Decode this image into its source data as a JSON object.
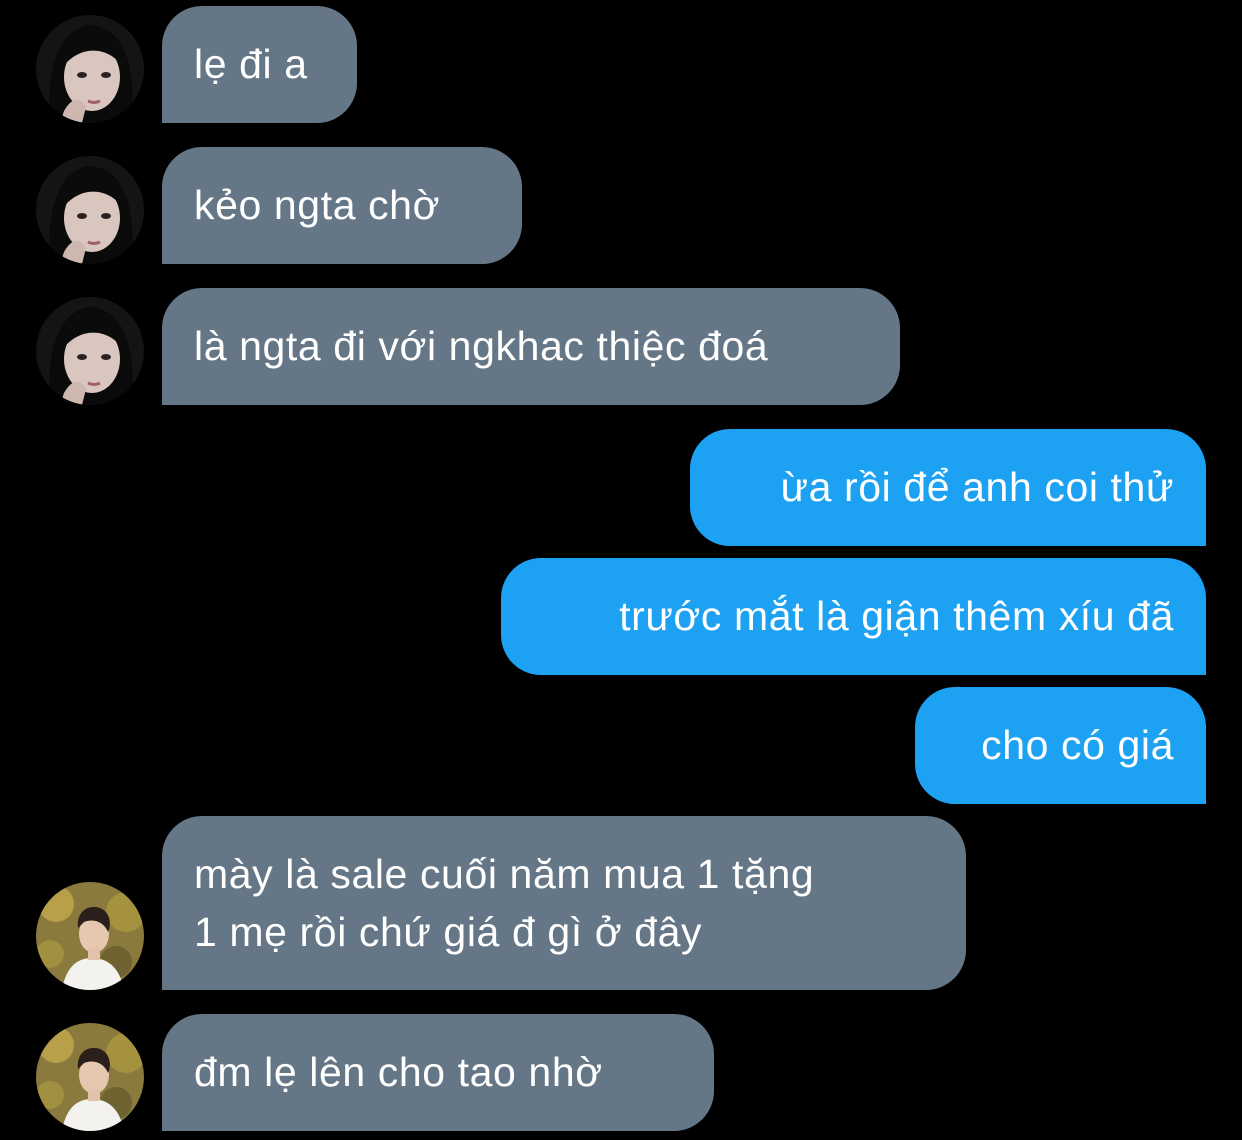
{
  "conversation": {
    "messages": [
      {
        "sender": "contact-a",
        "direction": "incoming",
        "text": "lẹ đi a"
      },
      {
        "sender": "contact-a",
        "direction": "incoming",
        "text": "kẻo ngta chờ"
      },
      {
        "sender": "contact-a",
        "direction": "incoming",
        "text": "là ngta đi với ngkhac thiệc đoá"
      },
      {
        "sender": "me",
        "direction": "outgoing",
        "text": "ừa rồi để anh coi thử"
      },
      {
        "sender": "me",
        "direction": "outgoing",
        "text": "trước mắt là giận thêm xíu đã"
      },
      {
        "sender": "me",
        "direction": "outgoing",
        "text": "cho có giá"
      },
      {
        "sender": "contact-b",
        "direction": "incoming",
        "text": "mày là sale cuối năm mua 1 tặng\n1 mẹ rồi chứ giá đ gì ở đây"
      },
      {
        "sender": "contact-b",
        "direction": "incoming",
        "text": "đm lẹ lên cho tao nhờ"
      }
    ]
  },
  "colors": {
    "background": "#000000",
    "incoming_bubble": "#657786",
    "outgoing_bubble": "#1da1f2",
    "text": "#ffffff"
  },
  "icons": {
    "contact_a_avatar": "avatar-photo-dark-haired-girl",
    "contact_b_avatar": "avatar-photo-boy-white-shirt-autumn"
  }
}
